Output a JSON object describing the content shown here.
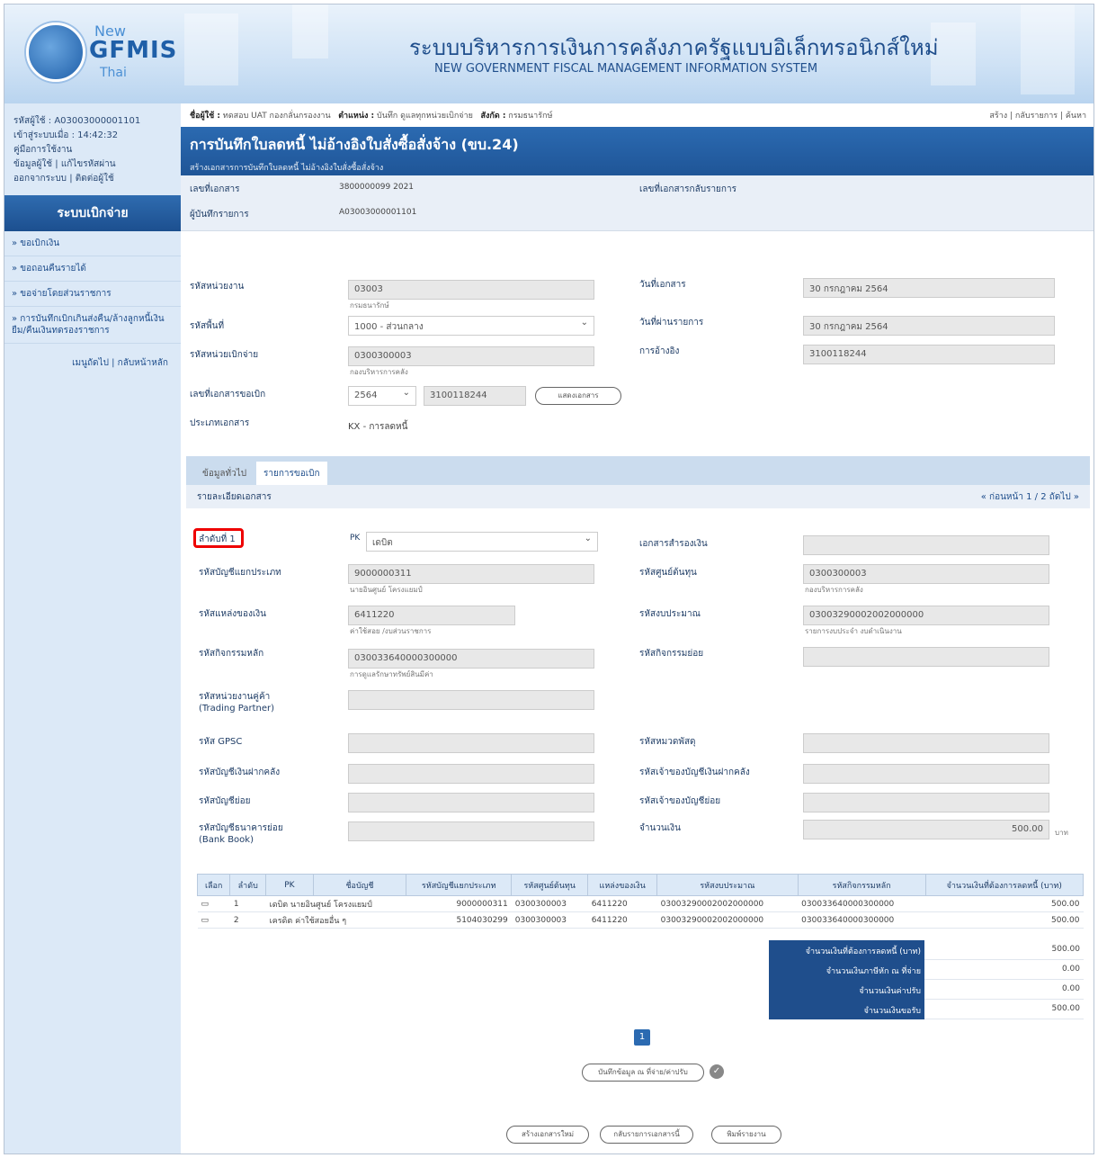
{
  "header": {
    "logo_new": "New",
    "logo_gfmis": "GFMIS",
    "logo_thai": "Thai",
    "system_th": "ระบบบริหารการเงินการคลังภาครัฐแบบอิเล็กทรอนิกส์ใหม่",
    "system_en": "NEW GOVERNMENT FISCAL MANAGEMENT INFORMATION SYSTEM"
  },
  "user": {
    "id": "รหัสผู้ใช้ : A03003000001101",
    "login": "เข้าสู่ระบบเมื่อ : 14:42:32",
    "manual": "คู่มือการใช้งาน",
    "info": "ข้อมูลผู้ใช้",
    "change_pwd": "แก้ไขรหัสผ่าน",
    "logout": "ออกจากระบบ",
    "contact": "ติดต่อผู้ใช้"
  },
  "sidebar": {
    "title": "ระบบเบิกจ่าย",
    "items": [
      "» ขอเบิกเงิน",
      "» ขอถอนคืนรายได้",
      "» ขอจ่ายโดยส่วนราชการ",
      "» การบันทึกเบิกเกินส่งคืน/ล้างลูกหนี้เงินยืม/คืนเงินทดรองราชการ"
    ],
    "back": "เมนูถัดไป | กลับหน้าหลัก"
  },
  "topbar": {
    "user_label": "ชื่อผู้ใช้ :",
    "user_val": "ทดสอบ UAT กองกลั่นกรองงาน",
    "pos_label": "ตำแหน่ง :",
    "pos_val": "บันทึก ดูแลทุกหน่วยเบิกจ่าย",
    "dept_label": "สังกัด :",
    "dept_val": "กรมธนารักษ์",
    "links": "สร้าง | กลับรายการ | ค้นหา"
  },
  "page": {
    "title": "การบันทึกใบลดหนี้ ไม่อ้างอิงใบสั่งซื้อสั่งจ้าง (ขบ.24)",
    "subtitle": "สร้างเอกสารการบันทึกใบลดหนี้ ไม่อ้างอิงใบสั่งซื้อสั่งจ้าง"
  },
  "doc": {
    "docno_label": "เลขที่เอกสาร",
    "docno": "3800000099   2021",
    "recorder_label": "ผู้บันทึกรายการ",
    "recorder": "A03003000001101",
    "reverse_label": "เลขที่เอกสารกลับรายการ"
  },
  "form": {
    "agency_label": "รหัสหน่วยงาน",
    "agency": "03003",
    "agency_sub": "กรมธนารักษ์",
    "area_label": "รหัสพื้นที่",
    "area": "1000 - ส่วนกลาง",
    "disb_label": "รหัสหน่วยเบิกจ่าย",
    "disb": "0300300003",
    "disb_sub": "กองบริหารการคลัง",
    "req_label": "เลขที่เอกสารขอเบิก",
    "req_year": "2564",
    "req_no": "3100118244",
    "show_btn": "แสดงเอกสาร",
    "type_label": "ประเภทเอกสาร",
    "type": "KX - การลดหนี้",
    "docdate_label": "วันที่เอกสาร",
    "docdate": "30 กรกฎาคม 2564",
    "postdate_label": "วันที่ผ่านรายการ",
    "postdate": "30 กรกฎาคม 2564",
    "ref_label": "การอ้างอิง",
    "ref": "3100118244"
  },
  "tabs": [
    "ข้อมูลทั่วไป",
    "รายการขอเบิก"
  ],
  "detail": {
    "head": "รายละเอียดเอกสาร",
    "pager": "« ก่อนหน้า 1 / 2 ถัดไป »",
    "item_label": "ลำดับที่ 1",
    "pk": "PK",
    "pk_val": "เดบิต",
    "gl_label": "รหัสบัญชีแยกประเภท",
    "gl": "9000000311",
    "gl_sub": "นายอินศูนย์ โครงแยมป์",
    "fund_label": "รหัสแหล่งของเงิน",
    "fund": "6411220",
    "fund_sub": "ค่าใช้สอย /งบส่วนราชการ",
    "act_label": "รหัสกิจกรรมหลัก",
    "act": "030033640000300000",
    "act_sub": "การดูแลรักษาทรัพย์สินมีค่า",
    "tp_label": "รหัสหน่วยงานคู่ค้า (Trading Partner)",
    "gpsc_label": "รหัส GPSC",
    "dep_label": "รหัสบัญชีเงินฝากคลัง",
    "sub_label": "รหัสบัญชีย่อย",
    "bank_label": "รหัสบัญชีธนาคารย่อย (Bank Book)",
    "src_label": "เอกสารสำรองเงิน",
    "cc_label": "รหัสศูนย์ต้นทุน",
    "cc": "0300300003",
    "cc_sub": "กองบริหารการคลัง",
    "bud_label": "รหัสงบประมาณ",
    "bud": "03003290002002000000",
    "bud_sub": "รายการงบประจำ งบดำเนินงาน",
    "subact_label": "รหัสกิจกรรมย่อย",
    "cat_label": "รหัสหมวดพัสดุ",
    "owner_label": "รหัสเจ้าของบัญชีเงินฝากคลัง",
    "subowner_label": "รหัสเจ้าของบัญชีย่อย",
    "amt_label": "จำนวนเงิน",
    "amt": "500.00",
    "amt_unit": "บาท"
  },
  "table": {
    "headers": [
      "เลือก",
      "ลำดับ",
      "PK",
      "ชื่อบัญชี",
      "รหัสบัญชีแยกประเภท",
      "รหัสศูนย์ต้นทุน",
      "แหล่งของเงิน",
      "รหัสงบประมาณ",
      "รหัสกิจกรรมหลัก",
      "จำนวนเงินที่ต้องการลดหนี้ (บาท)"
    ],
    "rows": [
      [
        "1",
        "เดบิต นายอินศูนย์ โครงแยมป์",
        "9000000311",
        "0300300003",
        "6411220",
        "03003290002002000000",
        "030033640000300000",
        "500.00"
      ],
      [
        "2",
        "เครดิต ค่าใช้สอยอื่น ๆ",
        "5104030299",
        "0300300003",
        "6411220",
        "03003290002002000000",
        "030033640000300000",
        "500.00"
      ]
    ],
    "totals": [
      [
        "จำนวนเงินที่ต้องการลดหนี้ (บาท)",
        "500.00"
      ],
      [
        "จำนวนเงินภาษีหัก ณ ที่จ่าย",
        "0.00"
      ],
      [
        "จำนวนเงินค่าปรับ",
        "0.00"
      ],
      [
        "จำนวนเงินขอรับ",
        "500.00"
      ]
    ],
    "page": "1"
  },
  "buttons": {
    "save": "บันทึกข้อมูล ณ ที่จ่าย/ค่าปรับ",
    "create": "สร้างเอกสารใหม่",
    "back": "กลับรายการเอกสารนี้",
    "print": "พิมพ์รายงาน"
  }
}
